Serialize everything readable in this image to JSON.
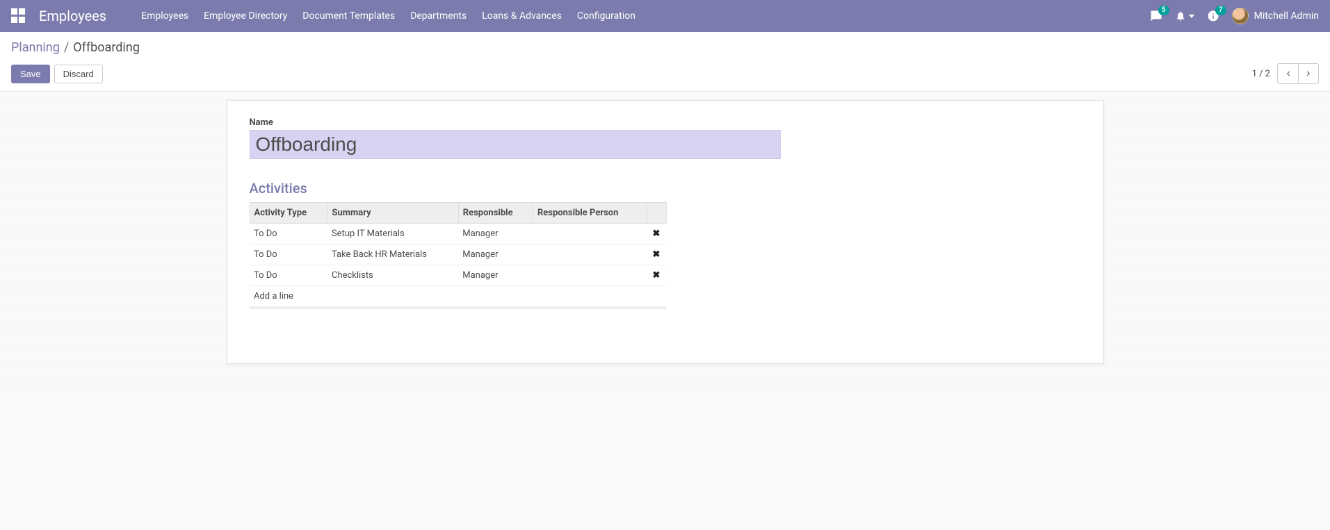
{
  "navbar": {
    "brand": "Employees",
    "menu": [
      "Employees",
      "Employee Directory",
      "Document Templates",
      "Departments",
      "Loans & Advances",
      "Configuration"
    ],
    "messages_badge": "5",
    "activities_badge": "7",
    "user_name": "Mitchell Admin"
  },
  "breadcrumb": {
    "parent": "Planning",
    "current": "Offboarding"
  },
  "buttons": {
    "save": "Save",
    "discard": "Discard"
  },
  "pager": {
    "value": "1 / 2"
  },
  "form": {
    "name_label": "Name",
    "name_value": "Offboarding",
    "section_title": "Activities",
    "columns": [
      "Activity Type",
      "Summary",
      "Responsible",
      "Responsible Person"
    ],
    "rows": [
      {
        "type": "To Do",
        "summary": "Setup IT Materials",
        "responsible": "Manager",
        "person": ""
      },
      {
        "type": "To Do",
        "summary": "Take Back HR Materials",
        "responsible": "Manager",
        "person": ""
      },
      {
        "type": "To Do",
        "summary": "Checklists",
        "responsible": "Manager",
        "person": ""
      }
    ],
    "add_line": "Add a line"
  }
}
